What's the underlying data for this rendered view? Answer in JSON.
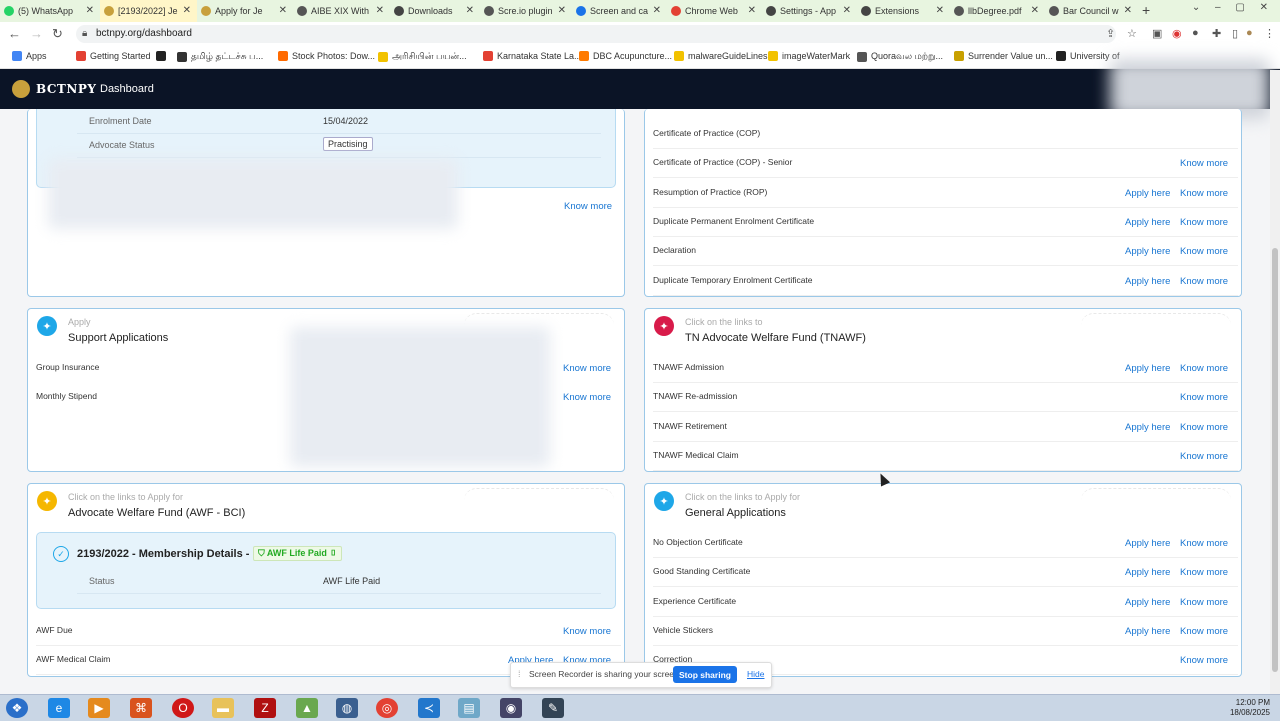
{
  "browser": {
    "tabs": [
      {
        "title": "(5) WhatsApp",
        "icon": "whatsapp-icon",
        "color": "#25d366"
      },
      {
        "title": "[2193/2022] Je",
        "icon": "bctnpy-icon",
        "color": "#c8a03c",
        "active": true
      },
      {
        "title": "Apply for Je",
        "icon": "bctnpy-icon",
        "color": "#c8a03c"
      },
      {
        "title": "AIBE XIX With",
        "icon": "globe-icon",
        "color": "#555"
      },
      {
        "title": "Downloads",
        "icon": "download-icon",
        "color": "#444"
      },
      {
        "title": "Scre.io plugin",
        "icon": "globe-icon",
        "color": "#555"
      },
      {
        "title": "Screen and ca",
        "icon": "screen-icon",
        "color": "#1a73e8"
      },
      {
        "title": "Chrome Web",
        "icon": "webstore-icon",
        "color": "#e34133"
      },
      {
        "title": "Settings - App",
        "icon": "gear-icon",
        "color": "#444"
      },
      {
        "title": "Extensions",
        "icon": "puzzle-icon",
        "color": "#444"
      },
      {
        "title": "llbDegree.pdf",
        "icon": "globe-icon",
        "color": "#555"
      },
      {
        "title": "Bar Council w",
        "icon": "globe-icon",
        "color": "#555"
      }
    ],
    "url": "bctnpy.org/dashboard",
    "bookmarks": [
      {
        "label": "Apps",
        "color": "#4285f4"
      },
      {
        "label": "Getting Started",
        "color": "#e34133"
      },
      {
        "label": "",
        "color": "#222"
      },
      {
        "label": "தமிழ் தட்டச்சு ப...",
        "color": "#333"
      },
      {
        "label": "Stock Photos: Dow...",
        "color": "#ff6a00"
      },
      {
        "label": "அரிசியின் பயன்...",
        "color": "#f2c200"
      },
      {
        "label": "Karnataka State La...",
        "color": "#e34133"
      },
      {
        "label": "DBC Acupuncture...",
        "color": "#ff7a00"
      },
      {
        "label": "malwareGuideLines",
        "color": "#f2c200"
      },
      {
        "label": "imageWaterMark",
        "color": "#f2c200"
      },
      {
        "label": "Quoraவல மற்று...",
        "color": "#555"
      },
      {
        "label": "Surrender Value un...",
        "color": "#c8a000"
      },
      {
        "label": "University of",
        "color": "#222"
      }
    ]
  },
  "app": {
    "brand": "BCTNPY",
    "nav_dashboard": "Dashboard"
  },
  "enrolment_card": {
    "rows": [
      {
        "key": "Enrolment Date",
        "value": "15/04/2022"
      },
      {
        "key": "Advocate Status",
        "value": "Practising"
      }
    ],
    "know_more": "Know more"
  },
  "cop_card": {
    "items": [
      {
        "label": "Certificate of Practice (COP)",
        "apply": "",
        "know": ""
      },
      {
        "label": "Certificate of Practice (COP) - Senior",
        "apply": "",
        "know": "Know more"
      },
      {
        "label": "Resumption of Practice (ROP)",
        "apply": "Apply here",
        "know": "Know more"
      },
      {
        "label": "Duplicate Permanent Enrolment Certificate",
        "apply": "Apply here",
        "know": "Know more"
      },
      {
        "label": "Declaration",
        "apply": "Apply here",
        "know": "Know more"
      },
      {
        "label": "Duplicate Temporary Enrolment Certificate",
        "apply": "Apply here",
        "know": "Know more"
      }
    ]
  },
  "support_card": {
    "subtitle": "Apply",
    "title": "Support Applications",
    "items": [
      {
        "label": "Group Insurance",
        "know": "Know more"
      },
      {
        "label": "Monthly Stipend",
        "know": "Know more"
      }
    ]
  },
  "tnawf_card": {
    "subtitle": "Click on the links to",
    "title": "TN Advocate Welfare Fund (TNAWF)",
    "items": [
      {
        "label": "TNAWF Admission",
        "apply": "Apply here",
        "know": "Know more"
      },
      {
        "label": "TNAWF Re-admission",
        "apply": "",
        "know": "Know more"
      },
      {
        "label": "TNAWF Retirement",
        "apply": "Apply here",
        "know": "Know more"
      },
      {
        "label": "TNAWF Medical Claim",
        "apply": "",
        "know": "Know more"
      }
    ]
  },
  "awf_card": {
    "subtitle": "Click on the links to Apply for",
    "title": "Advocate Welfare Fund (AWF - BCI)",
    "membership_title": "2193/2022 - Membership Details -",
    "membership_badge": "AWF Life Paid",
    "status_key": "Status",
    "status_value": "AWF Life Paid",
    "items": [
      {
        "label": "AWF Due",
        "apply": "",
        "know": "Know more"
      },
      {
        "label": "AWF Medical Claim",
        "apply": "Apply here",
        "know": "Know more"
      }
    ]
  },
  "general_card": {
    "subtitle": "Click on the links to Apply for",
    "title": "General Applications",
    "items": [
      {
        "label": "No Objection Certificate",
        "apply": "Apply here",
        "know": "Know more"
      },
      {
        "label": "Good Standing Certificate",
        "apply": "Apply here",
        "know": "Know more"
      },
      {
        "label": "Experience Certificate",
        "apply": "Apply here",
        "know": "Know more"
      },
      {
        "label": "Vehicle Stickers",
        "apply": "Apply here",
        "know": "Know more"
      },
      {
        "label": "Correction",
        "apply": "",
        "know": "Know more"
      }
    ]
  },
  "recorder": {
    "text": "Screen Recorder is sharing your screen.",
    "stop": "Stop sharing",
    "hide": "Hide"
  },
  "taskbar": {
    "time": "12:00 PM",
    "date": "18/08/2025"
  }
}
